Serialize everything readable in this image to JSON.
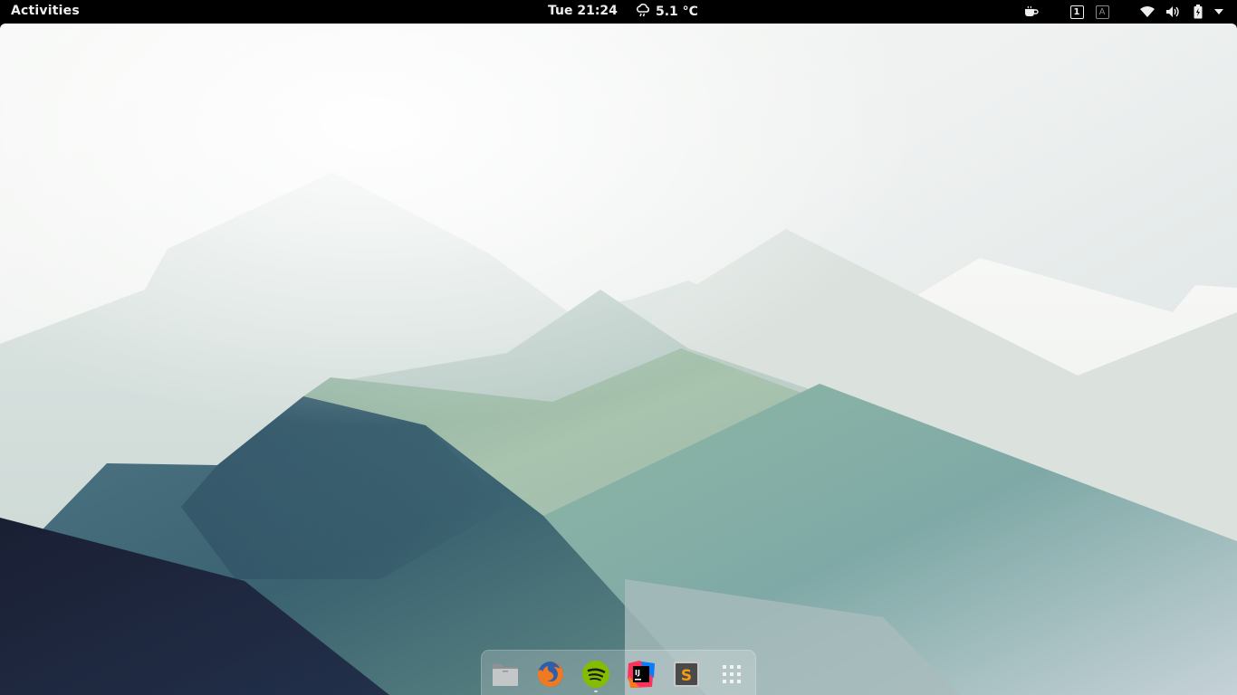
{
  "topbar": {
    "activities_label": "Activities",
    "clock": "Tue 21:24",
    "weather": {
      "icon": "cloud-rain-icon",
      "temperature": "5.1 °C"
    },
    "tray": {
      "items": [
        {
          "name": "caffeine-icon"
        },
        {
          "name": "workspace-indicator",
          "label": "1"
        },
        {
          "name": "keyboard-layout-indicator",
          "label": "A"
        },
        {
          "name": "wifi-icon"
        },
        {
          "name": "volume-icon"
        },
        {
          "name": "battery-icon"
        },
        {
          "name": "system-menu-arrow-icon"
        }
      ]
    }
  },
  "dock": {
    "apps": [
      {
        "name": "files-app-icon",
        "running": false
      },
      {
        "name": "firefox-app-icon",
        "running": false
      },
      {
        "name": "spotify-app-icon",
        "running": true
      },
      {
        "name": "intellij-app-icon",
        "running": false,
        "label": "IJ"
      },
      {
        "name": "sublime-text-app-icon",
        "running": false,
        "label": "S"
      },
      {
        "name": "show-applications-icon"
      }
    ]
  },
  "colors": {
    "topbar_bg": "#000000",
    "sky_light": "#f2f4f3",
    "mountain_dark": "#1c2535",
    "mountain_teal": "#2f5566",
    "mountain_green": "#7fa89a",
    "spotify_green": "#84bd00",
    "firefox_orange": "#f07a22",
    "sublime_orange": "#f39c12"
  }
}
